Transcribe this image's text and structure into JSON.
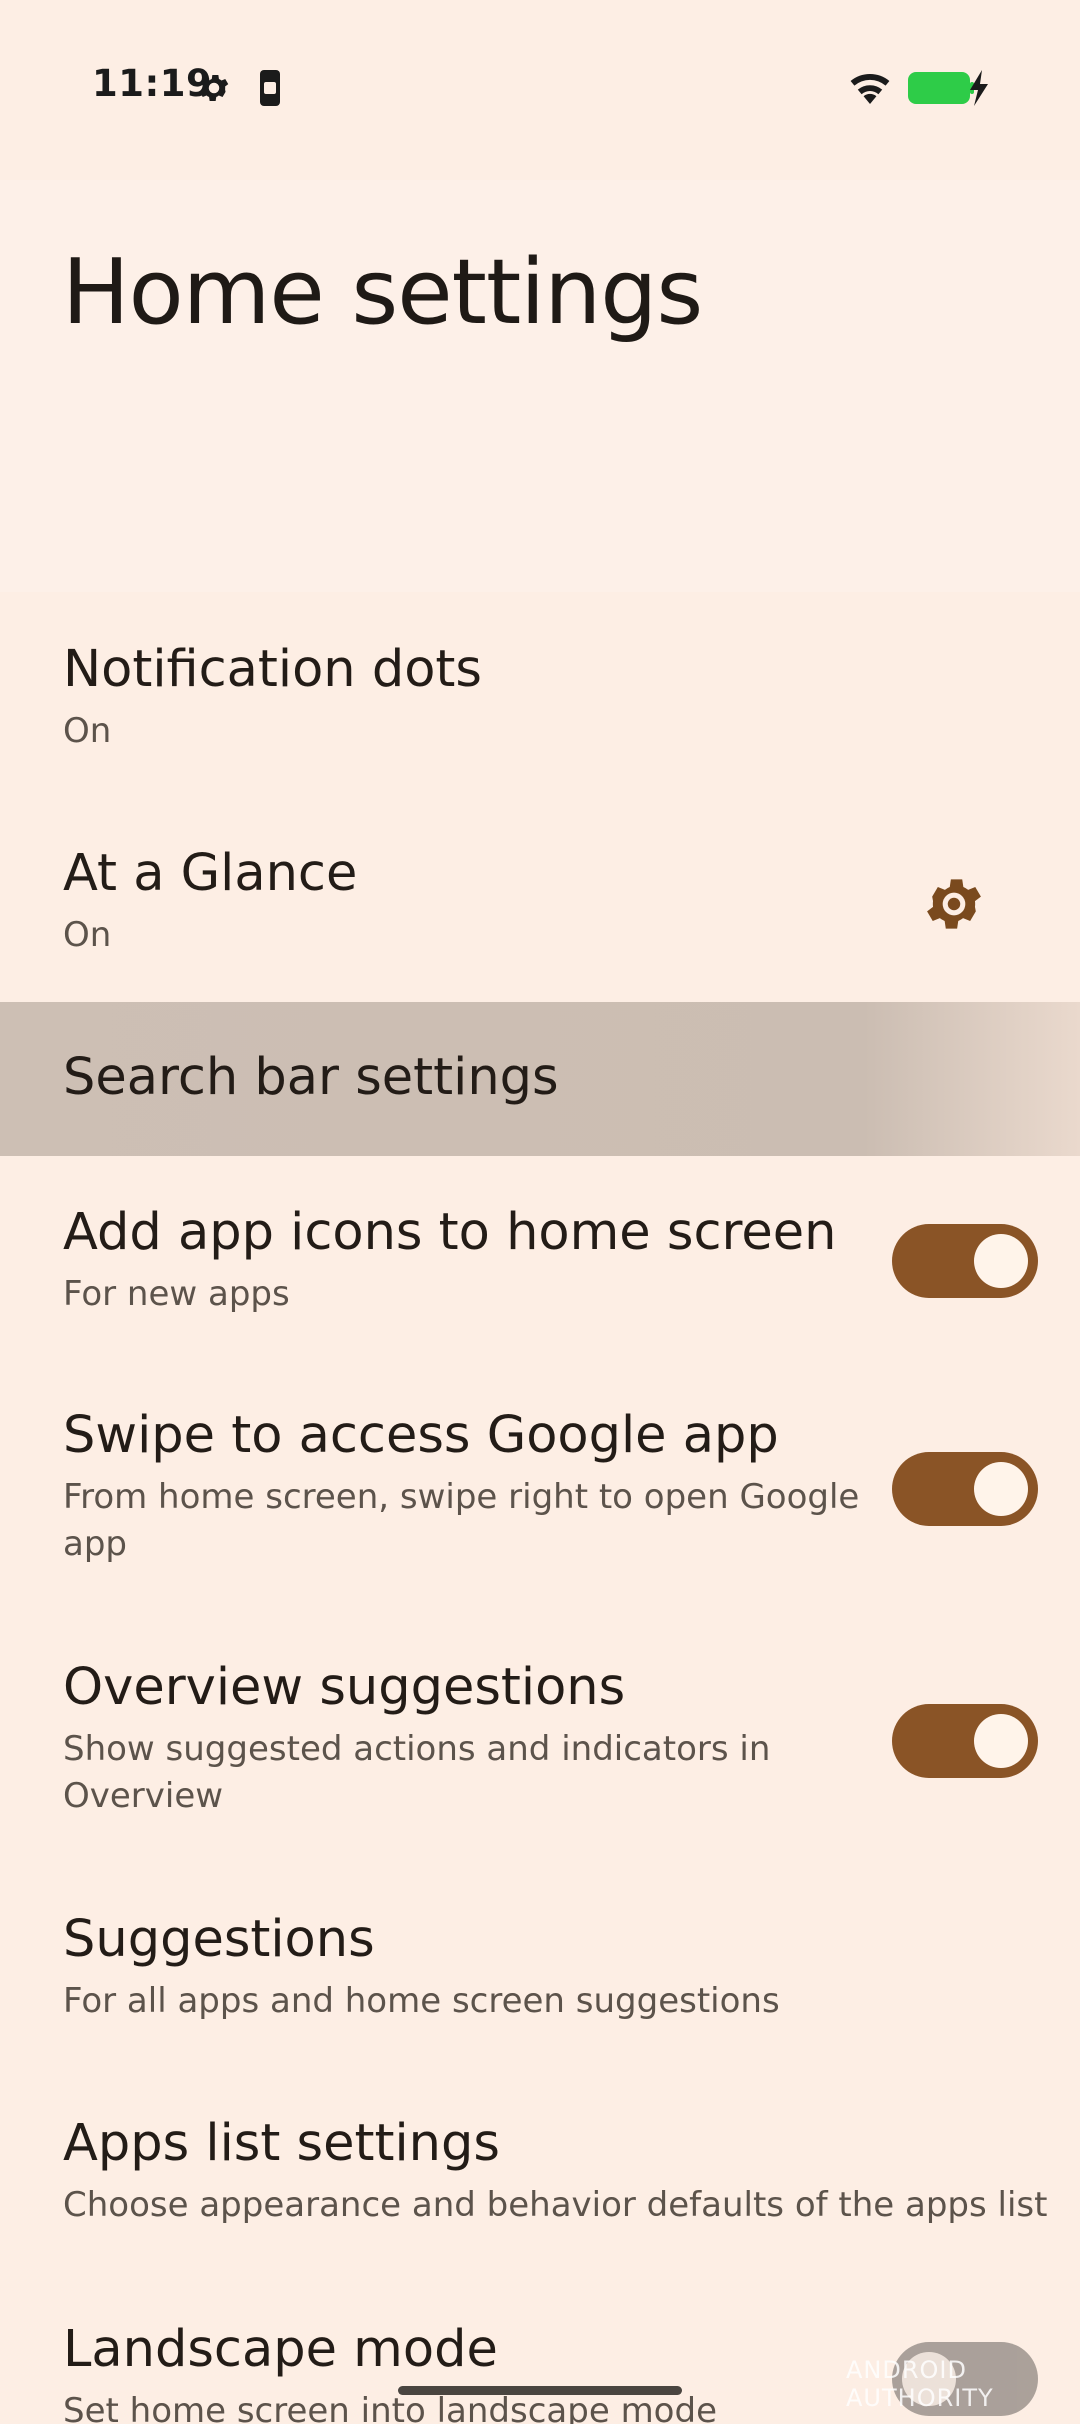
{
  "status_bar": {
    "time": "11:19",
    "icons": [
      "settings-gear-icon",
      "phone-device-icon",
      "wifi-icon",
      "battery-charging-icon"
    ],
    "battery_color": "#2ecc48"
  },
  "page": {
    "title": "Home settings"
  },
  "settings": [
    {
      "id": "notification-dots",
      "title": "Notification dots",
      "subtitle": "On"
    },
    {
      "id": "at-a-glance",
      "title": "At a Glance",
      "subtitle": "On",
      "action_icon": "gear-icon"
    },
    {
      "id": "search-bar-settings",
      "title": "Search bar settings",
      "highlighted": true
    },
    {
      "id": "add-app-icons",
      "title": "Add app icons to home screen",
      "subtitle": "For new apps",
      "toggle": true
    },
    {
      "id": "swipe-google-app",
      "title": "Swipe to access Google app",
      "subtitle": "From home screen, swipe right to open Google app",
      "toggle": true
    },
    {
      "id": "overview-suggestions",
      "title": "Overview suggestions",
      "subtitle": "Show suggested actions and indicators in Overview",
      "toggle": true
    },
    {
      "id": "suggestions",
      "title": "Suggestions",
      "subtitle": "For all apps and home screen suggestions"
    },
    {
      "id": "apps-list-settings",
      "title": "Apps list settings",
      "subtitle": "Choose appearance and behavior defaults of the apps list"
    },
    {
      "id": "landscape-mode",
      "title": "Landscape mode",
      "subtitle": "Set home screen into landscape mode",
      "toggle": false
    }
  ],
  "watermark": "ANDROID AUTHORITY",
  "colors": {
    "background": "#fdeee4",
    "accent": "#8a5426",
    "highlight": "#cbbdb2"
  }
}
